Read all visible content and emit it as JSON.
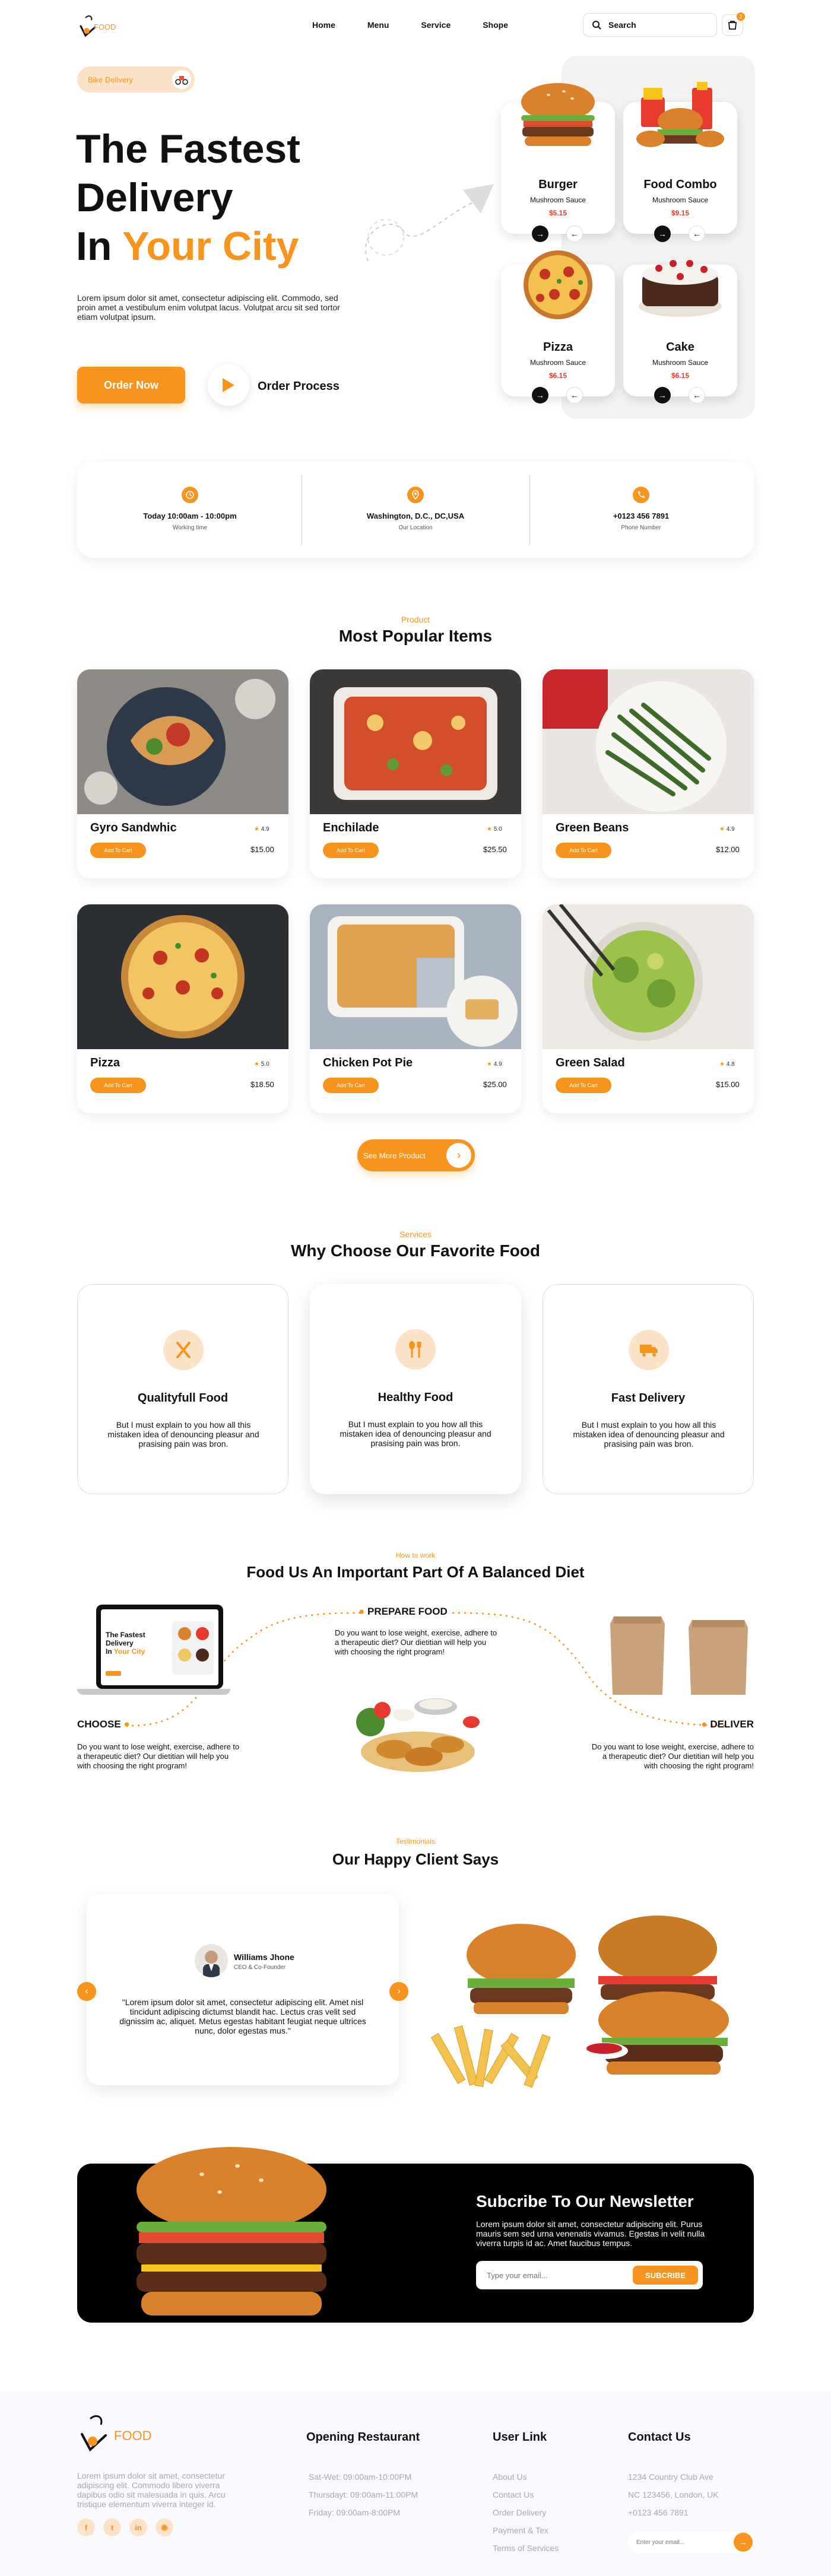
{
  "nav": {
    "logo_text": "FOOD",
    "links": [
      "Home",
      "Menu",
      "Service",
      "Shope"
    ],
    "search_label": "Search",
    "cart_badge": "2"
  },
  "hero": {
    "badge": "Bike Delivery",
    "title_line1": "The Fastest",
    "title_line2": "Delivery",
    "title_line3_prefix": "In",
    "title_line3_accent": "Your City",
    "description": "Lorem ipsum dolor sit amet, consectetur adipiscing elit. Commodo, sed proin amet a vestibulum enim volutpat lacus. Volutpat arcu sit sed tortor etiam volutpat ipsum.",
    "order_button": "Order Now",
    "process_label": "Order Process"
  },
  "hero_cards": [
    {
      "name": "Burger",
      "sub": "Mushroom Sauce",
      "price": "$5.15"
    },
    {
      "name": "Food Combo",
      "sub": "Mushroom Sauce",
      "price": "$9.15"
    },
    {
      "name": "Pizza",
      "sub": "Mushroom Sauce",
      "price": "$6.15"
    },
    {
      "name": "Cake",
      "sub": "Mushroom Sauce",
      "price": "$6.15"
    }
  ],
  "info": [
    {
      "title": "Today 10:00am - 10:00pm",
      "sub": "Working time"
    },
    {
      "title": "Washington, D.C., DC,USA",
      "sub": "Our Location"
    },
    {
      "title": "+0123 456 7891",
      "sub": "Phone Number"
    }
  ],
  "popular": {
    "kicker": "Product",
    "title": "Most Popular Items",
    "add_label": "Add To Cart",
    "more_label": "See More Product",
    "items": [
      {
        "name": "Gyro Sandwhic",
        "rating": "4.9",
        "price": "$15.00"
      },
      {
        "name": "Enchilade",
        "rating": "5.0",
        "price": "$25.50"
      },
      {
        "name": "Green Beans",
        "rating": "4.9",
        "price": "$12.00"
      },
      {
        "name": "Pizza",
        "rating": "5.0",
        "price": "$18.50"
      },
      {
        "name": "Chicken Pot Pie",
        "rating": "4.9",
        "price": "$25.00"
      },
      {
        "name": "Green Salad",
        "rating": "4.8",
        "price": "$15.00"
      }
    ]
  },
  "services": {
    "kicker": "Services",
    "title": "Why Choose Our Favorite Food",
    "items": [
      {
        "title": "Qualityfull Food",
        "text": "But I must explain to you how all this mistaken idea of denouncing pleasur and prasising pain was bron."
      },
      {
        "title": "Healthy Food",
        "text": "But I must explain to you how all this mistaken idea of denouncing pleasur and prasising pain was bron."
      },
      {
        "title": "Fast Delivery",
        "text": "But I must explain to you how all this mistaken idea of denouncing pleasur and prasising pain was bron."
      }
    ]
  },
  "how": {
    "kicker": "How to work",
    "title": "Food Us An Important Part Of A Balanced Diet",
    "choose_title": "CHOOSE",
    "choose_text": "Do you want to lose weight, exercise, adhere to a therapeutic diet? Our dietitian will help you with choosing the right program!",
    "prepare_title": "PREPARE FOOD",
    "prepare_text": "Do you want to lose weight, exercise, adhere to a therapeutic diet? Our dietitian will help you with choosing the right program!",
    "deliver_title": "DELIVER",
    "deliver_text": "Do you want to lose weight, exercise, adhere to a therapeutic diet? Our dietitian will help you with choosing the right program!",
    "laptop": {
      "title1": "The Fastest",
      "title2": "Delivery",
      "title3_prefix": "In",
      "title3_accent": "Your City"
    }
  },
  "testimonial": {
    "kicker": "Testimonials",
    "title": "Our Happy Client Says",
    "name": "Williams Jhone",
    "role": "CEO & Co-Founder",
    "quote": "\"Lorem ipsum dolor sit amet, consectetur adipiscing elit. Amet nisl tincidunt adipiscing dictumst blandit hac. Lectus cras velit sed dignissim ac, aliquet. Metus egestas habitant feugiat neque ultrices nunc, dolor egestas mus.\""
  },
  "newsletter": {
    "title": "Subcribe To Our Newsletter",
    "text": "Lorem ipsum dolor sit amet, consectetur adipiscing elit. Purus mauris sem sed urna venenatis vivamus. Egestas in velit nulla viverra turpis id ac. Amet faucibus tempus.",
    "placeholder": "Type your email...",
    "button": "SUBCRIBE"
  },
  "footer": {
    "logo_text": "FOOD",
    "about": "Lorem ipsum dolor sit amet, consectetur adipiscing elit. Commodo libero viverra dapibus odio sit malesuada in quis. Arcu tristique elementum viverra integer id.",
    "col1_title": "Opening Restaurant",
    "col1_items": [
      "Sat-Wet: 09:00am-10:00PM",
      "Thursdayt: 09:00am-11:00PM",
      "Friday: 09:00am-8:00PM"
    ],
    "col2_title": "User Link",
    "col2_items": [
      "About Us",
      "Contact Us",
      "Order Delivery",
      "Payment & Tex",
      "Terms of Services"
    ],
    "col3_title": "Contact Us",
    "col3_items": [
      "1234 Country Club Ave",
      "NC 123456, London, UK",
      "+0123 456 7891"
    ],
    "email_placeholder": "Enter your email..."
  },
  "colors": {
    "accent": "#F7941D",
    "dark": "#111111",
    "footer_bg": "#F8F8FD"
  }
}
